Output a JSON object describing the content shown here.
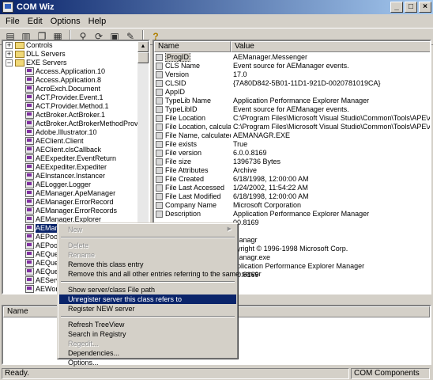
{
  "window": {
    "title": "COM Wiz"
  },
  "menubar": [
    "File",
    "Edit",
    "Options",
    "Help"
  ],
  "toolbar": {
    "icons": [
      "open-icon",
      "save-icon",
      "copy-icon",
      "paste-icon",
      "find-icon",
      "refresh-icon",
      "tools-icon",
      "wrench-icon",
      "help-icon"
    ]
  },
  "tree": {
    "top": [
      {
        "label": "Controls",
        "expander": "+"
      },
      {
        "label": "DLL Servers",
        "expander": "+"
      },
      {
        "label": "EXE Servers",
        "expander": "−"
      }
    ],
    "children": [
      "Access.Application.10",
      "Access.Application.8",
      "AcroExch.Document",
      "ACT.Provider.Event.1",
      "ACT.Provider.Method.1",
      "ActBroker.ActBroker.1",
      "ActBroker.ActBrokerMethodProv.1",
      "Adobe.Illustrator.10",
      "AEClient.Client",
      "AEClient.clsCallback",
      "AEExpediter.EventReturn",
      "AEExpediter.Expediter",
      "AEInstancer.Instancer",
      "AELogger.Logger",
      "AEManager.ApeManager",
      "AEManager.ErrorRecord",
      "AEManager.ErrorRecords",
      "AEManager.Explorer",
      "AEMana",
      "AEPoolM",
      "AEPoolM",
      "AEQueu",
      "AEQueu",
      "AEQueu",
      "AEServe",
      "AEWork",
      "AEWork"
    ],
    "selected_index": 18
  },
  "props": {
    "columns": {
      "name": "Name",
      "value": "Value"
    },
    "rows": [
      {
        "name": "ProgID",
        "value": "AEManager.Messenger"
      },
      {
        "name": "CLS Name",
        "value": "Event source for AEManager events."
      },
      {
        "name": "Version",
        "value": "17.0"
      },
      {
        "name": "CLSID",
        "value": "{7A80D842-5B01-11D1-921D-0020781019CA}"
      },
      {
        "name": "AppID",
        "value": ""
      },
      {
        "name": "TypeLib Name",
        "value": "Application Performance Explorer Manager"
      },
      {
        "name": "TypeLibID",
        "value": "Event source for AEManager events."
      },
      {
        "name": "File Location",
        "value": "C:\\Program Files\\Microsoft Visual Studio\\Common\\Tools\\APE\\AEMANAGR.EXE"
      },
      {
        "name": "File Location, calculated",
        "value": "C:\\Program Files\\Microsoft Visual Studio\\Common\\Tools\\APE\\AEMANAGR.EXE"
      },
      {
        "name": "File Name, calculated",
        "value": "AEMANAGR.EXE"
      },
      {
        "name": "File exists",
        "value": "True"
      },
      {
        "name": "File version",
        "value": "6.0.0.8169"
      },
      {
        "name": "File size",
        "value": "1396736 Bytes"
      },
      {
        "name": "File Attributes",
        "value": "Archive"
      },
      {
        "name": "File Created",
        "value": "6/18/1998, 12:00:00 AM"
      },
      {
        "name": "File Last Accessed",
        "value": "1/24/2002, 11:54:22 AM"
      },
      {
        "name": "File Last Modified",
        "value": "6/18/1998, 12:00:00 AM"
      },
      {
        "name": "Company Name",
        "value": "Microsoft Corporation"
      },
      {
        "name": "Description",
        "value": "Application Performance Explorer Manager"
      },
      {
        "name": "",
        "value": "00.8169"
      },
      {
        "name": "",
        "value": ""
      },
      {
        "name": "",
        "value": "Managr"
      },
      {
        "name": "",
        "value": "pyright © 1996-1998 Microsoft Corp."
      },
      {
        "name": "",
        "value": "Managr.exe"
      },
      {
        "name": "",
        "value": "pplication Performance Explorer Manager"
      },
      {
        "name": "",
        "value": "00.8169"
      }
    ]
  },
  "bottom": {
    "column": "Name"
  },
  "context_menu": {
    "items": [
      {
        "label": "New",
        "disabled": true,
        "arrow": "▶"
      },
      {
        "sep": true
      },
      {
        "label": "Delete",
        "disabled": true
      },
      {
        "label": "Rename",
        "disabled": true
      },
      {
        "label": "Remove this class entry"
      },
      {
        "label": "Remove this and all other entries referring to the same server"
      },
      {
        "sep": true
      },
      {
        "label": "Show server/class File path"
      },
      {
        "label": "Unregister server this class refers to",
        "highlight": true
      },
      {
        "label": "Register NEW server"
      },
      {
        "sep": true
      },
      {
        "label": "Refresh TreeView"
      },
      {
        "label": "Search in Registry"
      },
      {
        "label": "Regedit...",
        "disabled": true
      },
      {
        "label": "Dependencies..."
      },
      {
        "label": "Options..."
      }
    ]
  },
  "status": {
    "left": "Ready.",
    "right": "COM Components"
  }
}
